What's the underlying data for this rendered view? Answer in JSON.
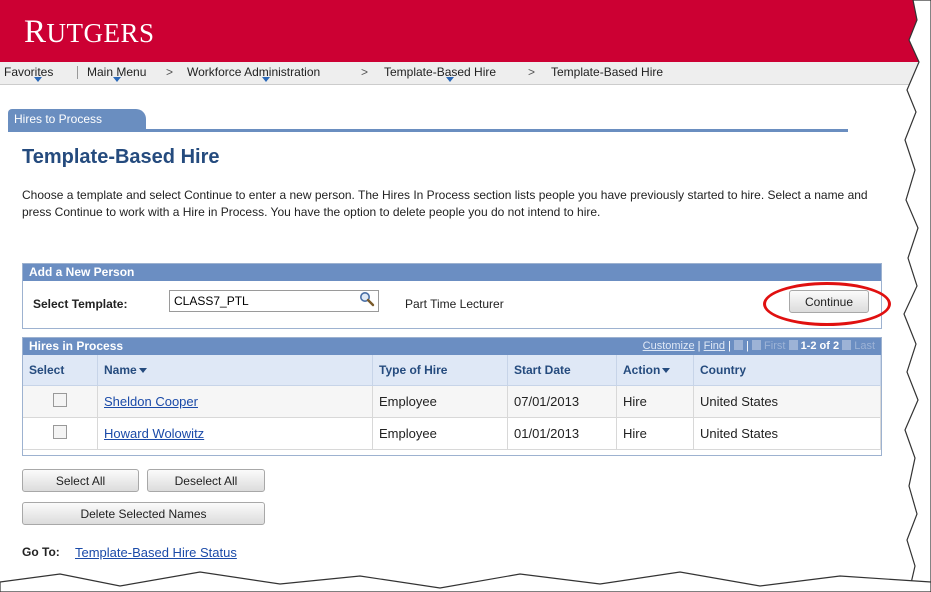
{
  "header": {
    "logo_first": "R",
    "logo_rest": "UTGERS"
  },
  "nav": {
    "favorites": "Favorites",
    "main_menu": "Main Menu",
    "workforce": "Workforce Administration",
    "tbh_1": "Template-Based Hire",
    "tbh_2": "Template-Based Hire",
    "separator": ">"
  },
  "tab": {
    "label": "Hires to Process"
  },
  "page": {
    "title": "Template-Based Hire",
    "description": "Choose a template and select Continue to enter a new person. The Hires In Process section lists people you have previously started to hire. Select a name and press Continue to work with a Hire in Process. You have the option to delete people you do not intend to hire."
  },
  "add_person": {
    "header": "Add a New Person",
    "template_label": "Select Template:",
    "template_value": "CLASS7_PTL",
    "template_description": "Part Time Lecturer",
    "continue_label": "Continue"
  },
  "hires": {
    "header": "Hires in Process",
    "customize": "Customize",
    "find": "Find",
    "first": "First",
    "count": "1-2 of 2",
    "last": "Last",
    "columns": [
      "Select",
      "Name",
      "Type of Hire",
      "Start Date",
      "Action",
      "Country"
    ],
    "rows": [
      {
        "name": "Sheldon Cooper",
        "type": "Employee",
        "start": "07/01/2013",
        "action": "Hire",
        "country": "United States"
      },
      {
        "name": "Howard Wolowitz",
        "type": "Employee",
        "start": "01/01/2013",
        "action": "Hire",
        "country": "United States"
      }
    ]
  },
  "buttons": {
    "select_all": "Select All",
    "deselect_all": "Deselect All",
    "delete_selected": "Delete Selected Names"
  },
  "goto": {
    "label": "Go To:",
    "link": "Template-Based Hire Status"
  },
  "colors": {
    "brand": "#cc0033",
    "panel_header": "#6b8ec2",
    "title": "#254b7e",
    "highlight_ring": "#e01010"
  }
}
